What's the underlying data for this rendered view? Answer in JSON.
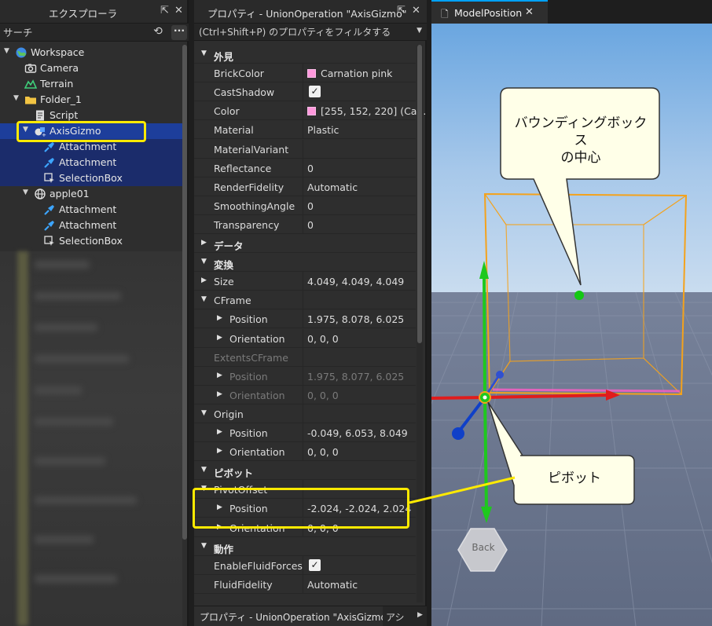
{
  "explorer": {
    "title": "エクスプローラ",
    "search_placeholder": "サーチ",
    "items": [
      {
        "label": "Workspace",
        "icon": "globe-icon"
      },
      {
        "label": "Camera",
        "icon": "camera-icon"
      },
      {
        "label": "Terrain",
        "icon": "terrain-icon"
      },
      {
        "label": "Folder_1",
        "icon": "folder-icon"
      },
      {
        "label": "Script",
        "icon": "script-icon"
      },
      {
        "label": "AxisGizmo",
        "icon": "union-icon"
      },
      {
        "label": "Attachment",
        "icon": "attachment-icon"
      },
      {
        "label": "Attachment",
        "icon": "attachment-icon"
      },
      {
        "label": "SelectionBox",
        "icon": "selectionbox-icon"
      },
      {
        "label": "apple01",
        "icon": "model-icon"
      },
      {
        "label": "Attachment",
        "icon": "attachment-icon"
      },
      {
        "label": "Attachment",
        "icon": "attachment-icon"
      },
      {
        "label": "SelectionBox",
        "icon": "selectionbox-icon"
      }
    ]
  },
  "properties": {
    "title": "プロパティ - UnionOperation \"AxisGizmo\"",
    "filter_placeholder": "(Ctrl+Shift+P) のプロパティをフィルタする",
    "rows": [
      {
        "kind": "cat",
        "name": "外見"
      },
      {
        "name": "BrickColor",
        "value": "Carnation pink",
        "swatch": true
      },
      {
        "name": "CastShadow",
        "check": true
      },
      {
        "name": "Color",
        "value": "[255, 152, 220] (Ca...",
        "swatch": true
      },
      {
        "name": "Material",
        "value": "Plastic"
      },
      {
        "name": "MaterialVariant",
        "value": ""
      },
      {
        "name": "Reflectance",
        "value": "0"
      },
      {
        "name": "RenderFidelity",
        "value": "Automatic"
      },
      {
        "name": "SmoothingAngle",
        "value": "0"
      },
      {
        "name": "Transparency",
        "value": "0"
      },
      {
        "kind": "cat-collapsed",
        "name": "データ"
      },
      {
        "kind": "cat",
        "name": "変換"
      },
      {
        "name": "Size",
        "value": "4.049, 4.049, 4.049",
        "tri": true
      },
      {
        "name": "CFrame",
        "value": "",
        "tri": "open"
      },
      {
        "name": "Position",
        "value": "1.975, 8.078, 6.025",
        "indent": true,
        "tri": true
      },
      {
        "name": "Orientation",
        "value": "0, 0, 0",
        "indent": true,
        "tri": true
      },
      {
        "name": "ExtentsCFrame",
        "value": "",
        "dim": true
      },
      {
        "name": "Position",
        "value": "1.975, 8.077, 6.025",
        "indent": true,
        "tri": true,
        "dim": true
      },
      {
        "name": "Orientation",
        "value": "0, 0, 0",
        "indent": true,
        "tri": true,
        "dim": true
      },
      {
        "name": "Origin",
        "value": "",
        "tri": "open"
      },
      {
        "name": "Position",
        "value": "-0.049, 6.053, 8.049",
        "indent": true,
        "tri": true
      },
      {
        "name": "Orientation",
        "value": "0, 0, 0",
        "indent": true,
        "tri": true
      },
      {
        "kind": "cat",
        "name": "ピボット"
      },
      {
        "name": "PivotOffset",
        "value": "",
        "tri": "open"
      },
      {
        "name": "Position",
        "value": "-2.024, -2.024, 2.024",
        "indent": true,
        "tri": true
      },
      {
        "name": "Orientation",
        "value": "0, 0, 0",
        "indent": true,
        "tri": true
      },
      {
        "kind": "cat",
        "name": "動作"
      },
      {
        "name": "EnableFluidForces",
        "check": true
      },
      {
        "name": "FluidFidelity",
        "value": "Automatic"
      }
    ],
    "bottom_tab": "プロパティ - UnionOperation \"AxisGizmo\"",
    "bottom_tab2": "アシ"
  },
  "viewport": {
    "tab_name": "ModelPosition",
    "callout_top": "バウンディングボックス\nの中心",
    "callout_bottom": "ピボット",
    "back_button": "Back"
  },
  "colors": {
    "selection": "#1d3e9b",
    "highlight": "#ffea00",
    "swatch": "#ff98dc",
    "bbox": "#f4a21c",
    "sky": "#7fb0de"
  }
}
